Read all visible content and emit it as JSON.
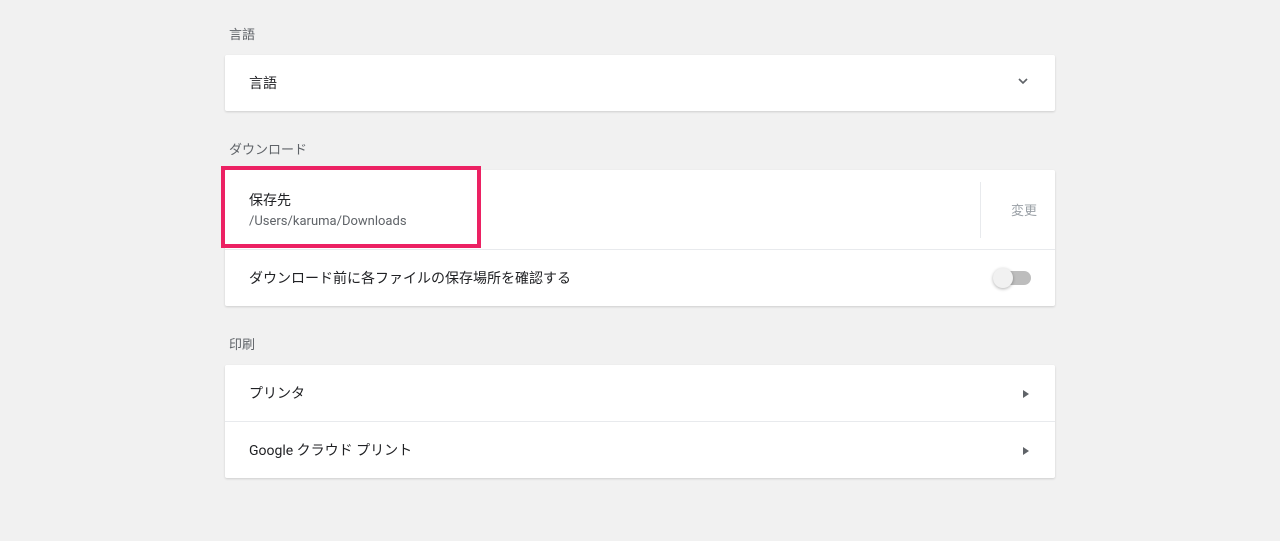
{
  "language": {
    "section_title": "言語",
    "row_label": "言語"
  },
  "downloads": {
    "section_title": "ダウンロード",
    "location_label": "保存先",
    "location_path": "/Users/karuma/Downloads",
    "change_button": "変更",
    "ask_before_label": "ダウンロード前に各ファイルの保存場所を確認する"
  },
  "printing": {
    "section_title": "印刷",
    "printers_label": "プリンタ",
    "cloud_print_label": "Google クラウド プリント"
  }
}
